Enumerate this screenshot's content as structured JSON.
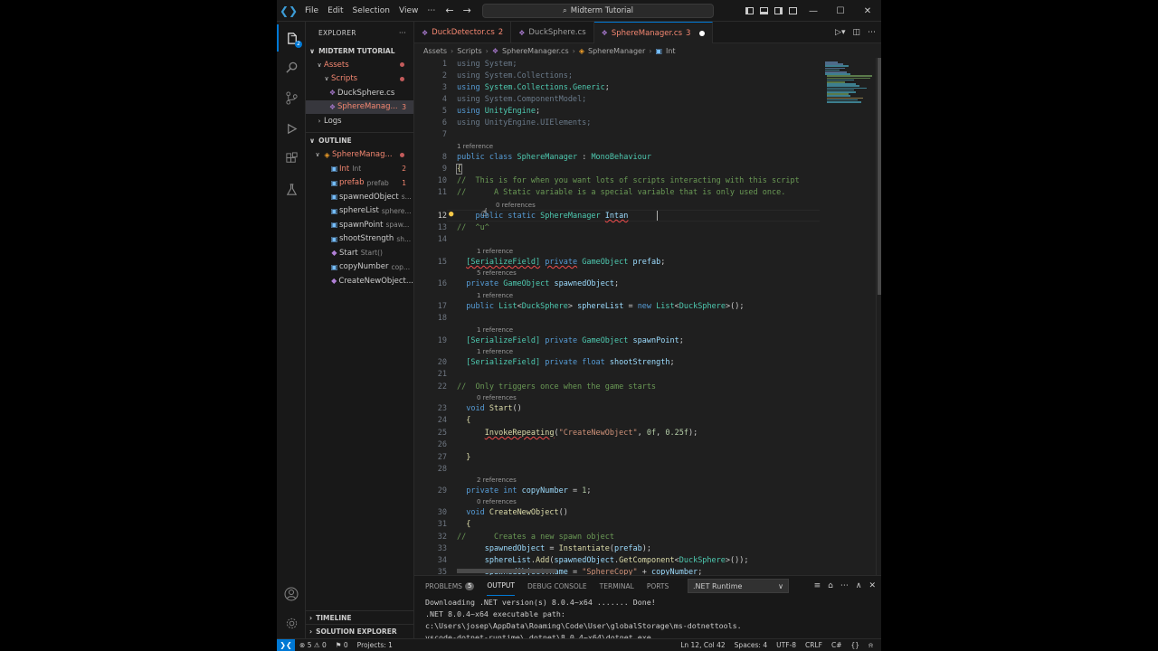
{
  "title_bar": {
    "menu": [
      "File",
      "Edit",
      "Selection",
      "View"
    ],
    "more": "⋯",
    "back": "←",
    "forward": "→",
    "search_text": "Midterm Tutorial",
    "search_icon": "⌕",
    "minimize": "—",
    "maximize": "☐",
    "close": "✕"
  },
  "activity_bar": {
    "explorer_badge": "2"
  },
  "sidebar": {
    "header": "EXPLORER",
    "header_more": "···",
    "workspace": "MIDTERM TUTORIAL",
    "tree": [
      {
        "label": "Assets"
      },
      {
        "label": "Scripts"
      },
      {
        "label": "DuckSphere.cs"
      },
      {
        "label": "SphereManag...",
        "count": "3"
      },
      {
        "label": "Logs"
      }
    ],
    "outline_header": "OUTLINE",
    "outline": [
      {
        "label": "SphereManag...",
        "desc": ""
      },
      {
        "label": "Int",
        "desc": "Int",
        "count": "2"
      },
      {
        "label": "prefab",
        "desc": "prefab",
        "count": "1"
      },
      {
        "label": "spawnedObject",
        "desc": "s..."
      },
      {
        "label": "sphereList",
        "desc": "sphere..."
      },
      {
        "label": "spawnPoint",
        "desc": "spaw..."
      },
      {
        "label": "shootStrength",
        "desc": "sh..."
      },
      {
        "label": "Start",
        "desc": "Start()"
      },
      {
        "label": "copyNumber",
        "desc": "cop..."
      },
      {
        "label": "CreateNewObject...",
        "desc": ""
      }
    ],
    "timeline": "TIMELINE",
    "solution_explorer": "SOLUTION EXPLORER"
  },
  "tabs": [
    {
      "label": "DuckDetector.cs",
      "count": "2"
    },
    {
      "label": "DuckSphere.cs",
      "count": ""
    },
    {
      "label": "SphereManager.cs",
      "count": "3"
    }
  ],
  "breadcrumb": [
    "Assets",
    "Scripts",
    "SphereManager.cs",
    "SphereManager",
    "Int"
  ],
  "editor": {
    "line_numbers": [
      "1",
      "2",
      "3",
      "4",
      "5",
      "6",
      "7",
      "8",
      "9",
      "10",
      "11",
      "12",
      "13",
      "14",
      "15",
      "16",
      "17",
      "18",
      "19",
      "20",
      "21",
      "22",
      "23",
      "24",
      "25",
      "26",
      "27",
      "28",
      "29",
      "30",
      "31",
      "32",
      "33",
      "34",
      "35"
    ],
    "lens": {
      "l8": "1 reference",
      "l12": "0 references",
      "l15": "1 reference",
      "l16": "5 references",
      "l17": "1 reference",
      "l19": "1 reference",
      "l20": "1 reference",
      "l23": "0 references",
      "l29": "2 references",
      "l30": "0 references"
    }
  },
  "panel": {
    "tabs": [
      "PROBLEMS",
      "OUTPUT",
      "DEBUG CONSOLE",
      "TERMINAL",
      "PORTS"
    ],
    "problems_count": "5",
    "channel": ".NET Runtime",
    "output_lines": [
      "Downloading .NET version(s) 8.0.4~x64 ....... Done!",
      ".NET 8.0.4~x64 executable path:",
      "c:\\Users\\josep\\AppData\\Roaming\\Code\\User\\globalStorage\\ms-dotnettools.",
      "vscode-dotnet-runtime\\.dotnet\\8.0.4~x64\\dotnet.exe"
    ]
  },
  "status_bar": {
    "errors": "5",
    "warnings": "0",
    "info": "0",
    "projects": "Projects: 1",
    "position": "Ln 12, Col 42",
    "spaces": "Spaces: 4",
    "encoding": "UTF-8",
    "eol": "CRLF",
    "language": "C#"
  },
  "colors": {
    "accent": "#0078d4",
    "error": "#f48771",
    "keyword": "#569cd6",
    "type": "#4ec9b0",
    "comment": "#6a9955"
  }
}
